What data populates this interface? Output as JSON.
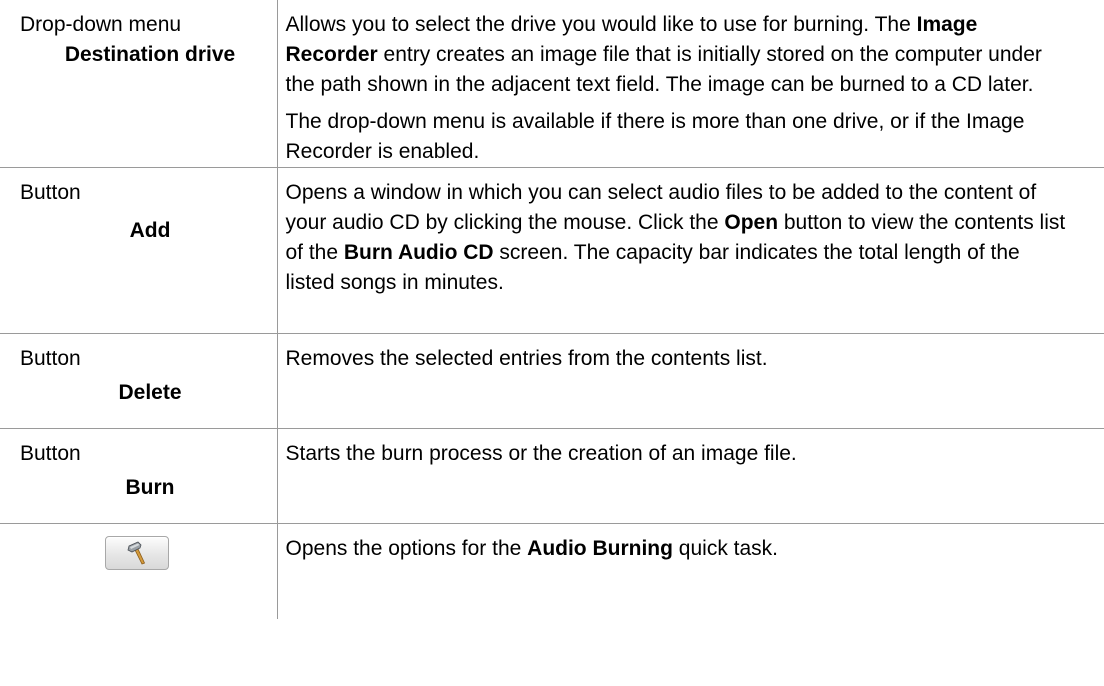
{
  "rows": [
    {
      "type": "Drop-down menu",
      "name": "Destination drive",
      "desc": [
        [
          {
            "t": "Allows you to select the drive you would like to use for burning. The "
          },
          {
            "t": "Image Recorder",
            "b": true
          },
          {
            "t": " entry creates an image file that is initially stored on the computer under the path shown in the adjacent text field. The image can be burned to a CD later."
          }
        ],
        [
          {
            "t": "The drop-down menu is available if there is more than one drive, or if the Image Recorder is enabled."
          }
        ]
      ]
    },
    {
      "type": "Button",
      "name": "Add",
      "desc": [
        [
          {
            "t": "Opens a window in which you can select audio files to be added to the content of your audio CD by clicking the mouse. Click the "
          },
          {
            "t": "Open",
            "b": true
          },
          {
            "t": " button to view the contents list of the "
          },
          {
            "t": "Burn Audio CD",
            "b": true
          },
          {
            "t": " screen. The capacity bar indicates the total length of the listed songs in minutes."
          }
        ]
      ]
    },
    {
      "type": "Button",
      "name": "Delete",
      "desc": [
        [
          {
            "t": "Removes the selected entries from the contents list."
          }
        ]
      ]
    },
    {
      "type": "Button",
      "name": "Burn",
      "desc": [
        [
          {
            "t": "Starts the burn process or the creation of an image file."
          }
        ]
      ]
    },
    {
      "icon": "hammer-icon",
      "desc": [
        [
          {
            "t": "Opens the options for the "
          },
          {
            "t": "Audio Burning",
            "b": true
          },
          {
            "t": " quick task."
          }
        ]
      ]
    }
  ]
}
